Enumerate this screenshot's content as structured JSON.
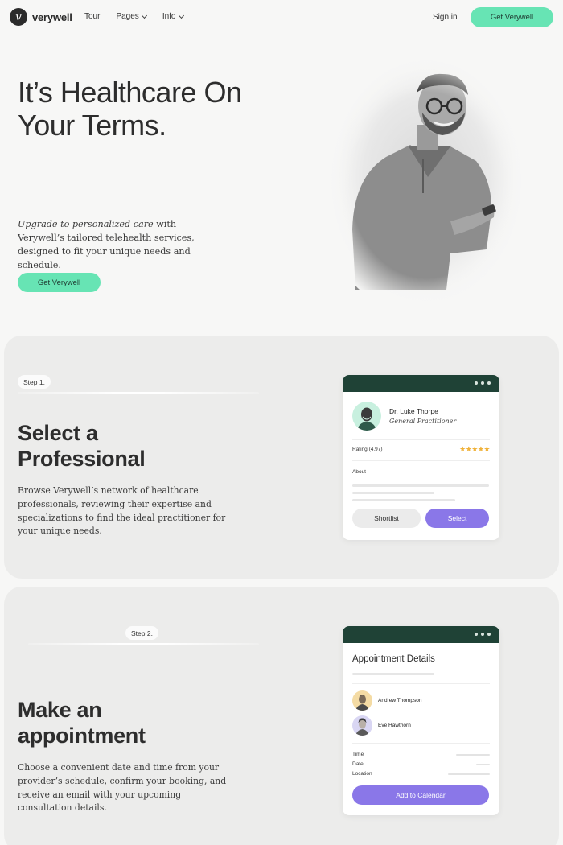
{
  "nav": {
    "brand": "verywell",
    "logo_letter": "v",
    "links": [
      {
        "label": "Tour",
        "has_dropdown": false
      },
      {
        "label": "Pages",
        "has_dropdown": true
      },
      {
        "label": "Info",
        "has_dropdown": true
      }
    ],
    "sign_in": "Sign in",
    "cta": "Get Verywell"
  },
  "hero": {
    "title_line1": "It’s Healthcare On",
    "title_line2": "Your Terms.",
    "body_em": "Upgrade to personalized care",
    "body_rest": " with Verywell’s tailored telehealth services, designed to fit your unique needs and schedule.",
    "cta": "Get Verywell"
  },
  "step1": {
    "label": "Step 1.",
    "title_line1": "Select a",
    "title_line2": "Professional",
    "body": "Browse Verywell’s network of healthcare professionals, reviewing their expertise and specializations to find the ideal practitioner for your unique needs.",
    "card": {
      "doctor_name": "Dr. Luke Thorpe",
      "doctor_role": "General Practitioner",
      "rating_label": "Rating (4.97)",
      "stars": "★★★★★",
      "about_label": "About",
      "shortlist_label": "Shortlist",
      "select_label": "Select"
    }
  },
  "step2": {
    "label": "Step 2.",
    "title_line1": "Make an",
    "title_line2": "appointment",
    "body": "Choose a convenient date and time from your provider’s schedule, confirm your booking, and receive an email with your upcoming consultation details.",
    "card": {
      "title": "Appointment Details",
      "people": [
        {
          "name": "Andrew Thompson"
        },
        {
          "name": "Eve Hawthorn"
        }
      ],
      "details": [
        {
          "label": "Time"
        },
        {
          "label": "Date"
        },
        {
          "label": "Location"
        }
      ],
      "button_label": "Add to Calendar"
    }
  },
  "colors": {
    "mint_cta": "#67e4b4",
    "card_header": "#1f4236",
    "purple_button": "#8a77e8",
    "star": "#f0b23a"
  }
}
